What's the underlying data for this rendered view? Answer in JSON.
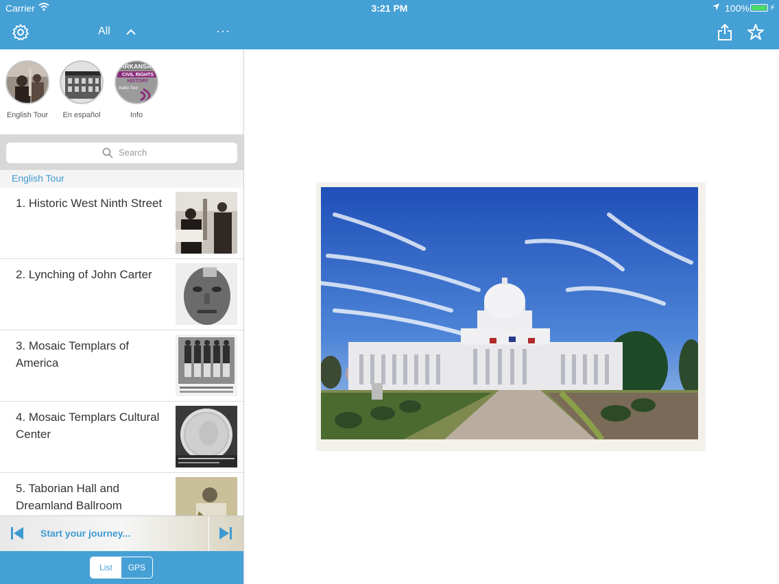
{
  "status_bar": {
    "carrier": "Carrier",
    "time": "3:21 PM",
    "battery": "100%"
  },
  "left_nav": {
    "filter_label": "All"
  },
  "tours": [
    {
      "label": "English Tour"
    },
    {
      "label": "En español"
    },
    {
      "label": "Info",
      "logo_text": [
        "ARKANSAS",
        "CIVIL RIGHTS",
        "HISTORY",
        "Audio Tour"
      ]
    }
  ],
  "search": {
    "placeholder": "Search"
  },
  "section": {
    "title": "English Tour"
  },
  "stops": [
    {
      "title": "1. Historic West Ninth Street"
    },
    {
      "title": "2. Lynching of John Carter"
    },
    {
      "title": "3. Mosaic Templars of America"
    },
    {
      "title": "4. Mosaic Templars Cultural Center"
    },
    {
      "title": "5. Taborian Hall and Dreamland Ballroom"
    }
  ],
  "player": {
    "message": "Start your journey..."
  },
  "view_toggle": {
    "options": [
      "List",
      "GPS"
    ],
    "selected": "List"
  },
  "colors": {
    "accent": "#45a0d5",
    "link": "#3d9ad1"
  }
}
